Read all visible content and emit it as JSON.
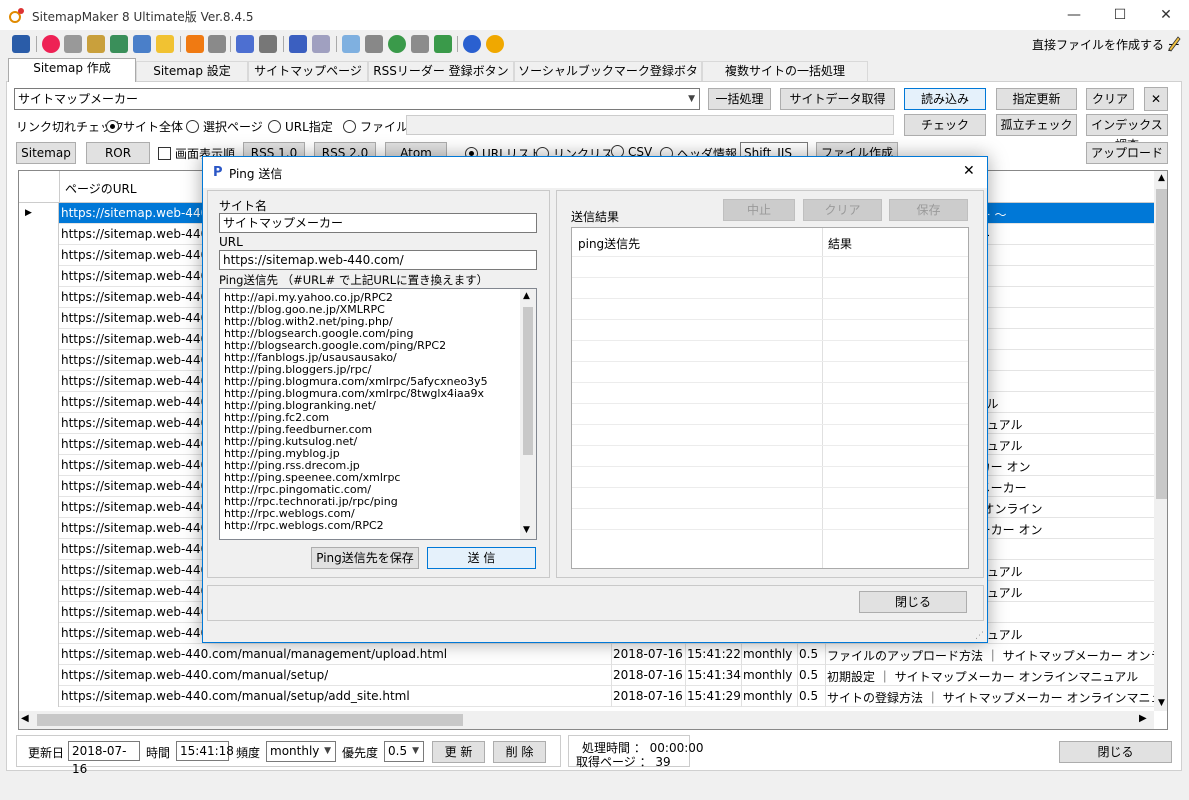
{
  "window": {
    "title": "SitemapMaker 8 Ultimate版  Ver.8.4.5",
    "minimize": "—",
    "maximize": "☐",
    "close": "✕"
  },
  "toolbar": {
    "direct_file": "直接ファイルを作成する ー",
    "icons": [
      "import-icon",
      "globe-icon",
      "tools-icon",
      "site-icon",
      "tree-icon",
      "monitor-icon",
      "folder-icon",
      "rss-icon",
      "settings-icon",
      "edit-icon",
      "wrench-icon",
      "ping-icon",
      "list-icon",
      "chat-icon",
      "sitemap-icon",
      "globe2-icon",
      "link-icon",
      "upload-icon",
      "help-icon",
      "info-icon"
    ]
  },
  "tabs": [
    {
      "label": "Sitemap 作成"
    },
    {
      "label": "Sitemap 設定"
    },
    {
      "label": "サイトマップページ作成"
    },
    {
      "label": "RSSリーダー 登録ボタン作成"
    },
    {
      "label": "ソーシャルブックマーク登録ボタン作成"
    },
    {
      "label": "複数サイトの一括処理"
    }
  ],
  "site_select": {
    "value": "サイトマップメーカー"
  },
  "buttons": {
    "batch": "一括処理",
    "fetch": "サイトデータ取得",
    "load": "読み込み",
    "update": "指定更新",
    "clear": "クリア",
    "check": "チェック",
    "orphan": "孤立チェック",
    "index": "インデックス調査",
    "upload": "アップロード",
    "sitemap": "Sitemap",
    "ror": "ROR",
    "rss10": "RSS 1.0",
    "rss20": "RSS 2.0",
    "atom": "Atom",
    "file_create": "ファイル作成"
  },
  "link_check": {
    "label": "リンク切れチェック",
    "opt_all": "サイト全体",
    "opt_page": "選択ページ",
    "opt_url": "URL指定",
    "opt_file": "ファイル"
  },
  "screen_display": "画面表示順",
  "output_opts": {
    "urllist": "URLリスト",
    "linklist": "リンクリスト",
    "csv": "CSV",
    "header": "ヘッダ情報"
  },
  "encoding": "Shift_JIS",
  "grid": {
    "header_url": "ページのURL",
    "rows": [
      {
        "url": "https://sitemap.web-440.co",
        "title": "ット ～ サイトマップメーカー ～"
      },
      {
        "url": "https://sitemap.web-440.co",
        "title": "いて ｜ サイトマップメーカー"
      },
      {
        "url": "https://sitemap.web-440.co",
        "title": "プメーカー"
      },
      {
        "url": "https://sitemap.web-440.co",
        "title": "プメーカー"
      },
      {
        "url": "https://sitemap.web-440.co",
        "title": "カー"
      },
      {
        "url": "https://sitemap.web-440.co",
        "title": ""
      },
      {
        "url": "https://sitemap.web-440.co",
        "title": ""
      },
      {
        "url": "https://sitemap.web-440.co",
        "title": "-"
      },
      {
        "url": "https://sitemap.web-440.co",
        "title": "トマップメーカー"
      },
      {
        "url": "https://sitemap.web-440.co",
        "title": "メーカー オンラインマニュアル"
      },
      {
        "url": "https://sitemap.web-440.co",
        "title": "ップメーカー オンラインマニュアル"
      },
      {
        "url": "https://sitemap.web-440.co",
        "title": "ップメーカー オンラインマニュアル"
      },
      {
        "url": "https://sitemap.web-440.co",
        "title": "録方法 ｜ サイトマップメーカー オン"
      },
      {
        "url": "https://sitemap.web-440.co",
        "title": "の登録方法 ｜ サイトマップメーカー"
      },
      {
        "url": "https://sitemap.web-440.co",
        "title": "法 ｜ サイトマップメーカー オンライン"
      },
      {
        "url": "https://sitemap.web-440.co",
        "title": "登録方法 ｜ サイトマップメーカー オン"
      },
      {
        "url": "https://sitemap.web-440.co",
        "title": "カー オンラインマニュアル"
      },
      {
        "url": "https://sitemap.web-440.co",
        "title": "ップメーカー オンラインマニュアル"
      },
      {
        "url": "https://sitemap.web-440.co",
        "title": "ップメーカー オンラインマニュアル"
      },
      {
        "url": "https://sitemap.web-440.co",
        "title": "ーカー オンラインマニュアル"
      },
      {
        "url": "https://sitemap.web-440.co",
        "title": "ップメーカー オンラインマニュアル"
      },
      {
        "url": "https://sitemap.web-440.com/manual/management/upload.html",
        "date": "2018-07-16",
        "time": "15:41:22",
        "freq": "monthly",
        "prio": "0.5",
        "title": "ファイルのアップロード方法 ｜ サイトマップメーカー オンラインマニュアル"
      },
      {
        "url": "https://sitemap.web-440.com/manual/setup/",
        "date": "2018-07-16",
        "time": "15:41:34",
        "freq": "monthly",
        "prio": "0.5",
        "title": "初期設定 ｜ サイトマップメーカー オンラインマニュアル"
      },
      {
        "url": "https://sitemap.web-440.com/manual/setup/add_site.html",
        "date": "2018-07-16",
        "time": "15:41:29",
        "freq": "monthly",
        "prio": "0.5",
        "title": "サイトの登録方法 ｜ サイトマップメーカー オンラインマニュアル"
      }
    ]
  },
  "bottom": {
    "date_label": "更新日",
    "date_value": "2018-07-16",
    "time_label": "時間",
    "time_value": "15:41:18",
    "freq_label": "頻度",
    "freq_value": "monthly",
    "prio_label": "優先度",
    "prio_value": "0.5",
    "update_btn": "更 新",
    "delete_btn": "削 除",
    "proc_time": "処理時間 ： 00:00:00",
    "pages": "取得ページ ： 39",
    "close_btn": "閉じる"
  },
  "dialog": {
    "title": "Ping 送信",
    "site_name_label": "サイト名",
    "site_name_value": "サイトマップメーカー",
    "url_label": "URL",
    "url_value": "https://sitemap.web-440.com/",
    "ping_label": "Ping送信先 （#URL# で上記URLに置き換えます）",
    "ping_targets": [
      "http://api.my.yahoo.co.jp/RPC2",
      "http://blog.goo.ne.jp/XMLRPC",
      "http://blog.with2.net/ping.php/",
      "http://blogsearch.google.com/ping",
      "http://blogsearch.google.com/ping/RPC2",
      "http://fanblogs.jp/usausausako/",
      "http://ping.bloggers.jp/rpc/",
      "http://ping.blogmura.com/xmlrpc/5afycxneo3y5",
      "http://ping.blogmura.com/xmlrpc/8twglx4iaa9x",
      "http://ping.blogranking.net/",
      "http://ping.fc2.com",
      "http://ping.feedburner.com",
      "http://ping.kutsulog.net/",
      "http://ping.myblog.jp",
      "http://ping.rss.drecom.jp",
      "http://ping.speenee.com/xmlrpc",
      "http://rpc.pingomatic.com/",
      "http://rpc.technorati.jp/rpc/ping",
      "http://rpc.weblogs.com/",
      "http://rpc.weblogs.com/RPC2"
    ],
    "save_targets": "Ping送信先を保存",
    "send": "送 信",
    "result_label": "送信結果",
    "stop": "中止",
    "clear": "クリア",
    "save": "保存",
    "col_target": "ping送信先",
    "col_result": "結果",
    "close": "閉じる"
  }
}
